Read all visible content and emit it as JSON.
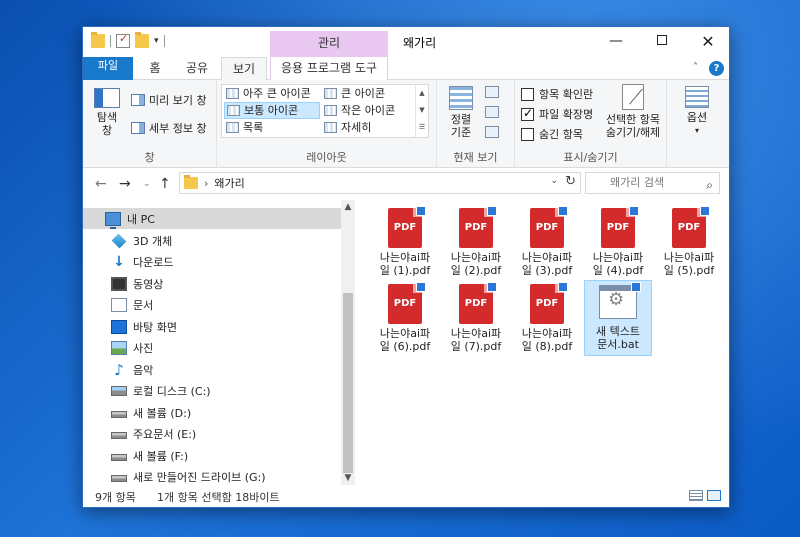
{
  "window": {
    "title": "왜가리",
    "context_tab": "관리"
  },
  "tabs": [
    "파일",
    "홈",
    "공유",
    "보기",
    "응용 프로그램 도구"
  ],
  "ribbon": {
    "pane": {
      "label": "창",
      "nav_pane": "탐색\n창",
      "preview_pane": "미리 보기 창",
      "details_pane": "세부 정보 창"
    },
    "layout": {
      "label": "레이아웃",
      "items": [
        "아주 큰 아이콘",
        "큰 아이콘",
        "보통 아이콘",
        "작은 아이콘",
        "목록",
        "자세히"
      ],
      "selected": "보통 아이콘"
    },
    "current_view": {
      "label": "현재 보기",
      "sort_by": "정렬\n기준"
    },
    "show_hide": {
      "label": "표시/숨기기",
      "item_checkboxes": "항목 확인란",
      "file_extensions": "파일 확장명",
      "hidden_items": "숨긴 항목",
      "hide_selected": "선택한 항목\n숨기기/해제",
      "item_checkboxes_checked": false,
      "file_extensions_checked": true,
      "hidden_items_checked": false
    },
    "options": {
      "label": "옵션"
    }
  },
  "address": {
    "path": "왜가리",
    "search_placeholder": "왜가리 검색"
  },
  "sidebar": {
    "items": [
      {
        "label": "내 PC",
        "icon": "pc-icon"
      },
      {
        "label": "3D 개체",
        "icon": "3d-objects-icon"
      },
      {
        "label": "다운로드",
        "icon": "download-icon"
      },
      {
        "label": "동영상",
        "icon": "video-icon"
      },
      {
        "label": "문서",
        "icon": "document-icon"
      },
      {
        "label": "바탕 화면",
        "icon": "desktop-icon"
      },
      {
        "label": "사진",
        "icon": "pictures-icon"
      },
      {
        "label": "음악",
        "icon": "music-icon"
      },
      {
        "label": "로컬 디스크 (C:)",
        "icon": "os-drive-icon"
      },
      {
        "label": "새 볼륨 (D:)",
        "icon": "drive-icon"
      },
      {
        "label": "주요문서 (E:)",
        "icon": "drive-icon"
      },
      {
        "label": "새 볼륨 (F:)",
        "icon": "drive-icon"
      },
      {
        "label": "새로 만들어진 드라이브 (G:)",
        "icon": "drive-icon"
      }
    ]
  },
  "files": [
    {
      "line1": "나는야ai파",
      "line2": "일 (1).pdf",
      "icon_text": "PDF"
    },
    {
      "line1": "나는야ai파",
      "line2": "일 (2).pdf",
      "icon_text": "PDF"
    },
    {
      "line1": "나는야ai파",
      "line2": "일 (3).pdf",
      "icon_text": "PDF"
    },
    {
      "line1": "나는야ai파",
      "line2": "일 (4).pdf",
      "icon_text": "PDF"
    },
    {
      "line1": "나는야ai파",
      "line2": "일 (5).pdf",
      "icon_text": "PDF"
    },
    {
      "line1": "나는야ai파",
      "line2": "일 (6).pdf",
      "icon_text": "PDF"
    },
    {
      "line1": "나는야ai파",
      "line2": "일 (7).pdf",
      "icon_text": "PDF"
    },
    {
      "line1": "나는야ai파",
      "line2": "일 (8).pdf",
      "icon_text": "PDF"
    },
    {
      "line1": "새 텍스트",
      "line2": "문서.bat",
      "icon_text": ""
    }
  ],
  "status": {
    "item_count": "9개 항목",
    "selection": "1개 항목 선택함 18바이트"
  },
  "colors": {
    "accent": "#1979ca",
    "context_tab": "#e8c8f0",
    "selection": "#cce8ff",
    "pdf_red": "#d32b2b"
  }
}
